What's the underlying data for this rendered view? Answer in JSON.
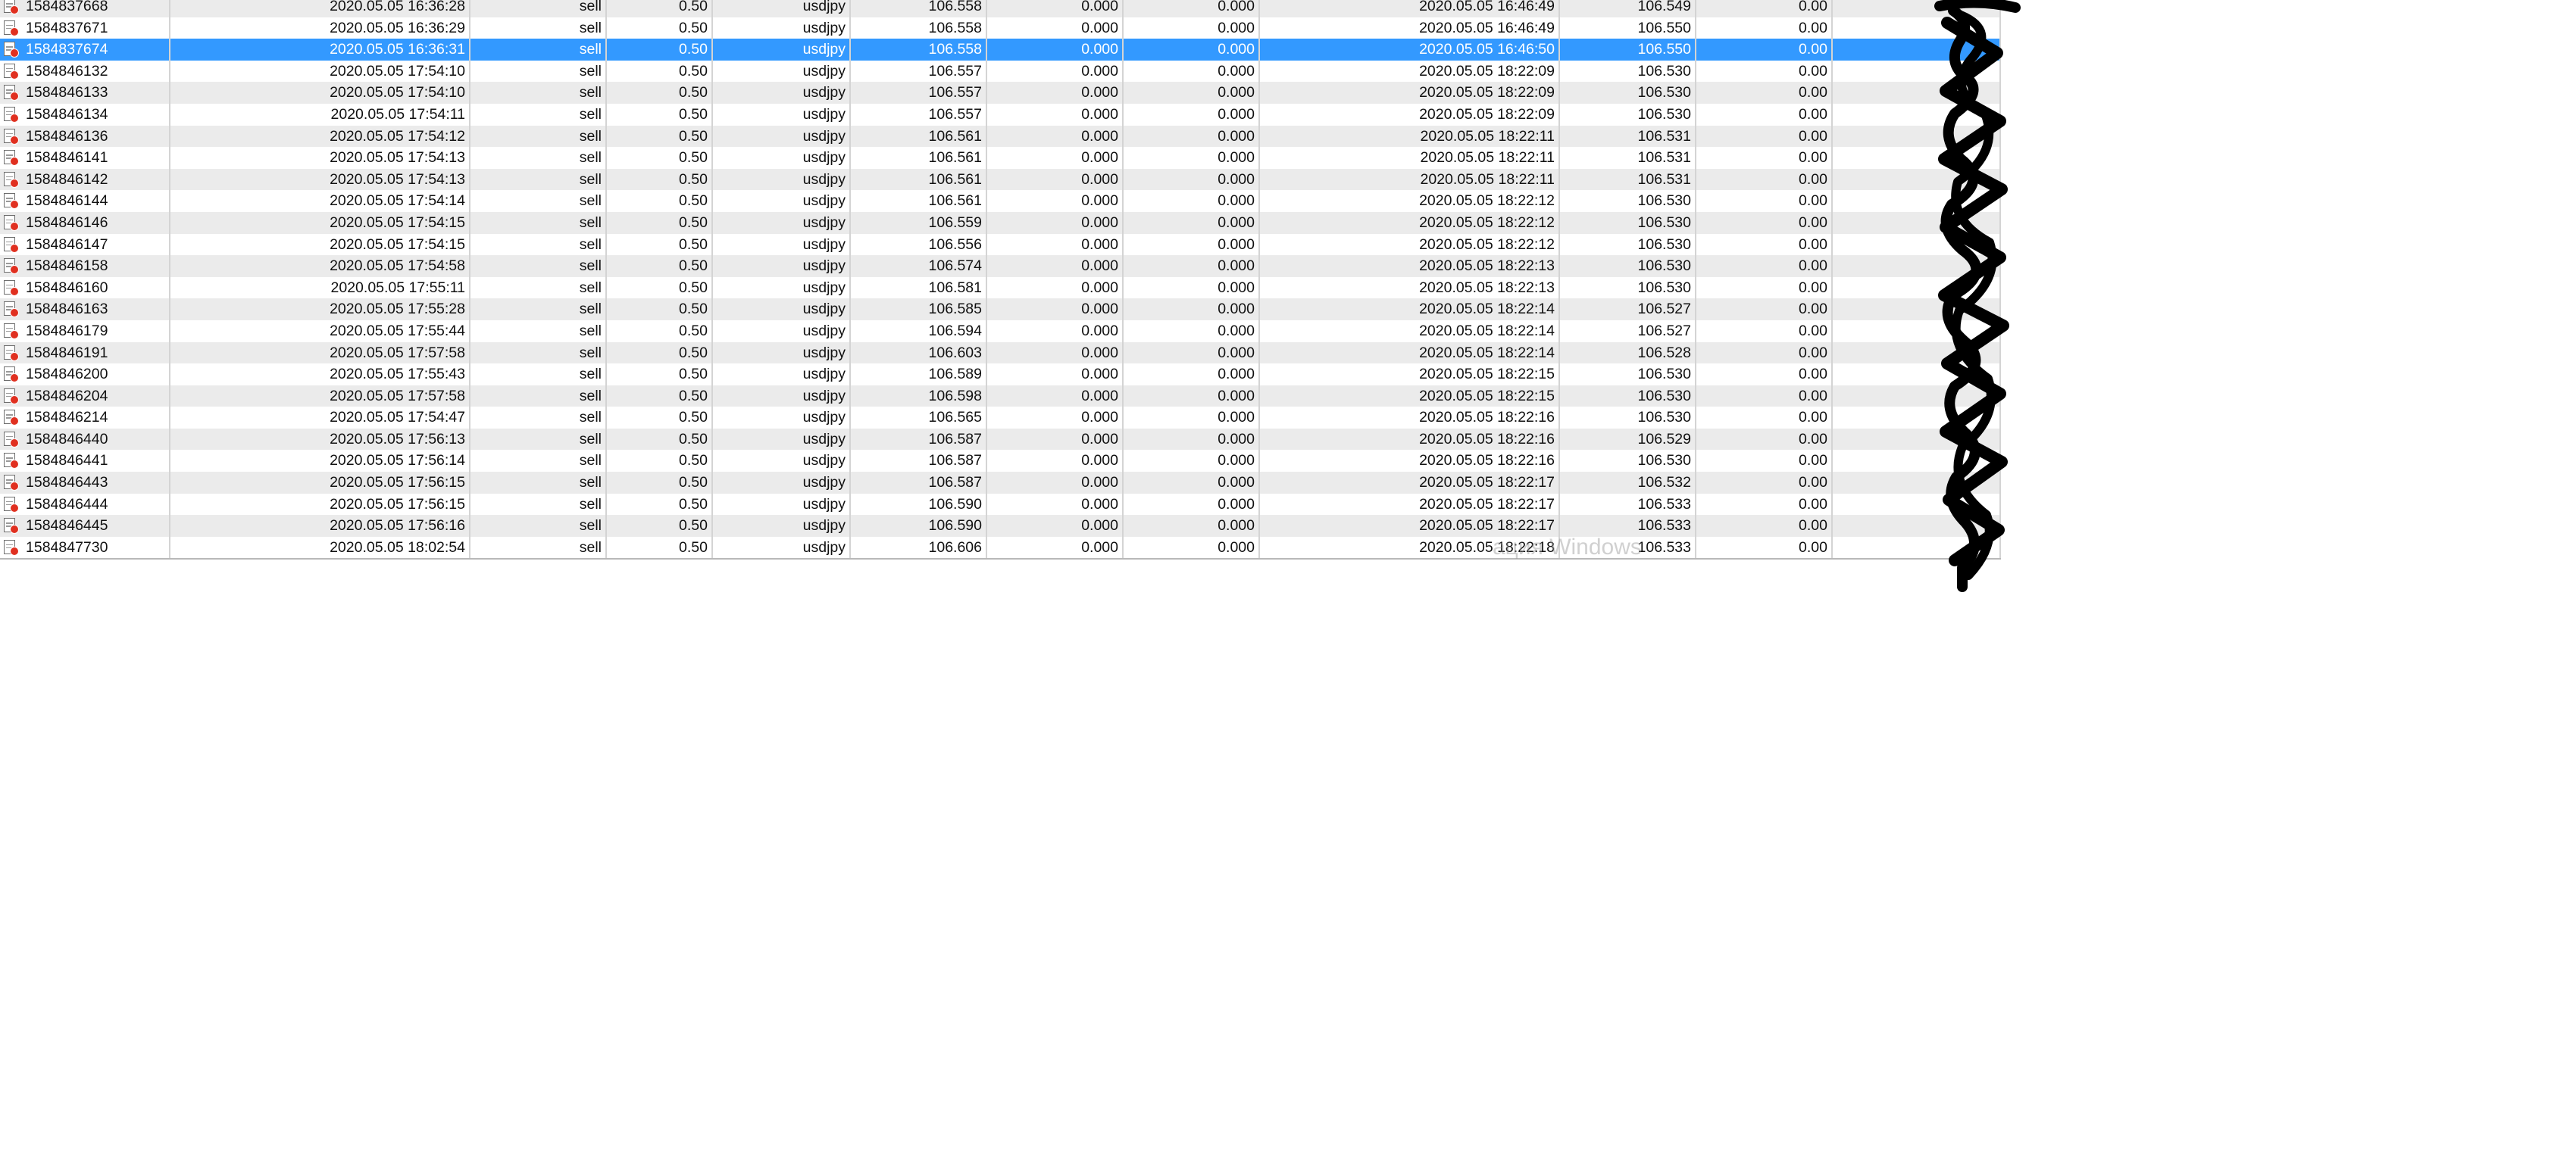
{
  "rows": [
    {
      "ticket": "1584837668",
      "open_time": "2020.05.05 16:36:28",
      "type": "sell",
      "volume": "0.50",
      "symbol": "usdjpy",
      "open_price": "106.558",
      "sl": "0.000",
      "tp": "0.000",
      "close_time": "2020.05.05 16:46:49",
      "close_price": "106.549",
      "commission": "0.00"
    },
    {
      "ticket": "1584837671",
      "open_time": "2020.05.05 16:36:29",
      "type": "sell",
      "volume": "0.50",
      "symbol": "usdjpy",
      "open_price": "106.558",
      "sl": "0.000",
      "tp": "0.000",
      "close_time": "2020.05.05 16:46:49",
      "close_price": "106.550",
      "commission": "0.00"
    },
    {
      "ticket": "1584837674",
      "open_time": "2020.05.05 16:36:31",
      "type": "sell",
      "volume": "0.50",
      "symbol": "usdjpy",
      "open_price": "106.558",
      "sl": "0.000",
      "tp": "0.000",
      "close_time": "2020.05.05 16:46:50",
      "close_price": "106.550",
      "commission": "0.00",
      "selected": true
    },
    {
      "ticket": "1584846132",
      "open_time": "2020.05.05 17:54:10",
      "type": "sell",
      "volume": "0.50",
      "symbol": "usdjpy",
      "open_price": "106.557",
      "sl": "0.000",
      "tp": "0.000",
      "close_time": "2020.05.05 18:22:09",
      "close_price": "106.530",
      "commission": "0.00"
    },
    {
      "ticket": "1584846133",
      "open_time": "2020.05.05 17:54:10",
      "type": "sell",
      "volume": "0.50",
      "symbol": "usdjpy",
      "open_price": "106.557",
      "sl": "0.000",
      "tp": "0.000",
      "close_time": "2020.05.05 18:22:09",
      "close_price": "106.530",
      "commission": "0.00"
    },
    {
      "ticket": "1584846134",
      "open_time": "2020.05.05 17:54:11",
      "type": "sell",
      "volume": "0.50",
      "symbol": "usdjpy",
      "open_price": "106.557",
      "sl": "0.000",
      "tp": "0.000",
      "close_time": "2020.05.05 18:22:09",
      "close_price": "106.530",
      "commission": "0.00"
    },
    {
      "ticket": "1584846136",
      "open_time": "2020.05.05 17:54:12",
      "type": "sell",
      "volume": "0.50",
      "symbol": "usdjpy",
      "open_price": "106.561",
      "sl": "0.000",
      "tp": "0.000",
      "close_time": "2020.05.05 18:22:11",
      "close_price": "106.531",
      "commission": "0.00"
    },
    {
      "ticket": "1584846141",
      "open_time": "2020.05.05 17:54:13",
      "type": "sell",
      "volume": "0.50",
      "symbol": "usdjpy",
      "open_price": "106.561",
      "sl": "0.000",
      "tp": "0.000",
      "close_time": "2020.05.05 18:22:11",
      "close_price": "106.531",
      "commission": "0.00"
    },
    {
      "ticket": "1584846142",
      "open_time": "2020.05.05 17:54:13",
      "type": "sell",
      "volume": "0.50",
      "symbol": "usdjpy",
      "open_price": "106.561",
      "sl": "0.000",
      "tp": "0.000",
      "close_time": "2020.05.05 18:22:11",
      "close_price": "106.531",
      "commission": "0.00"
    },
    {
      "ticket": "1584846144",
      "open_time": "2020.05.05 17:54:14",
      "type": "sell",
      "volume": "0.50",
      "symbol": "usdjpy",
      "open_price": "106.561",
      "sl": "0.000",
      "tp": "0.000",
      "close_time": "2020.05.05 18:22:12",
      "close_price": "106.530",
      "commission": "0.00"
    },
    {
      "ticket": "1584846146",
      "open_time": "2020.05.05 17:54:15",
      "type": "sell",
      "volume": "0.50",
      "symbol": "usdjpy",
      "open_price": "106.559",
      "sl": "0.000",
      "tp": "0.000",
      "close_time": "2020.05.05 18:22:12",
      "close_price": "106.530",
      "commission": "0.00"
    },
    {
      "ticket": "1584846147",
      "open_time": "2020.05.05 17:54:15",
      "type": "sell",
      "volume": "0.50",
      "symbol": "usdjpy",
      "open_price": "106.556",
      "sl": "0.000",
      "tp": "0.000",
      "close_time": "2020.05.05 18:22:12",
      "close_price": "106.530",
      "commission": "0.00"
    },
    {
      "ticket": "1584846158",
      "open_time": "2020.05.05 17:54:58",
      "type": "sell",
      "volume": "0.50",
      "symbol": "usdjpy",
      "open_price": "106.574",
      "sl": "0.000",
      "tp": "0.000",
      "close_time": "2020.05.05 18:22:13",
      "close_price": "106.530",
      "commission": "0.00"
    },
    {
      "ticket": "1584846160",
      "open_time": "2020.05.05 17:55:11",
      "type": "sell",
      "volume": "0.50",
      "symbol": "usdjpy",
      "open_price": "106.581",
      "sl": "0.000",
      "tp": "0.000",
      "close_time": "2020.05.05 18:22:13",
      "close_price": "106.530",
      "commission": "0.00"
    },
    {
      "ticket": "1584846163",
      "open_time": "2020.05.05 17:55:28",
      "type": "sell",
      "volume": "0.50",
      "symbol": "usdjpy",
      "open_price": "106.585",
      "sl": "0.000",
      "tp": "0.000",
      "close_time": "2020.05.05 18:22:14",
      "close_price": "106.527",
      "commission": "0.00"
    },
    {
      "ticket": "1584846179",
      "open_time": "2020.05.05 17:55:44",
      "type": "sell",
      "volume": "0.50",
      "symbol": "usdjpy",
      "open_price": "106.594",
      "sl": "0.000",
      "tp": "0.000",
      "close_time": "2020.05.05 18:22:14",
      "close_price": "106.527",
      "commission": "0.00"
    },
    {
      "ticket": "1584846191",
      "open_time": "2020.05.05 17:57:58",
      "type": "sell",
      "volume": "0.50",
      "symbol": "usdjpy",
      "open_price": "106.603",
      "sl": "0.000",
      "tp": "0.000",
      "close_time": "2020.05.05 18:22:14",
      "close_price": "106.528",
      "commission": "0.00"
    },
    {
      "ticket": "1584846200",
      "open_time": "2020.05.05 17:55:43",
      "type": "sell",
      "volume": "0.50",
      "symbol": "usdjpy",
      "open_price": "106.589",
      "sl": "0.000",
      "tp": "0.000",
      "close_time": "2020.05.05 18:22:15",
      "close_price": "106.530",
      "commission": "0.00"
    },
    {
      "ticket": "1584846204",
      "open_time": "2020.05.05 17:57:58",
      "type": "sell",
      "volume": "0.50",
      "symbol": "usdjpy",
      "open_price": "106.598",
      "sl": "0.000",
      "tp": "0.000",
      "close_time": "2020.05.05 18:22:15",
      "close_price": "106.530",
      "commission": "0.00"
    },
    {
      "ticket": "1584846214",
      "open_time": "2020.05.05 17:54:47",
      "type": "sell",
      "volume": "0.50",
      "symbol": "usdjpy",
      "open_price": "106.565",
      "sl": "0.000",
      "tp": "0.000",
      "close_time": "2020.05.05 18:22:16",
      "close_price": "106.530",
      "commission": "0.00"
    },
    {
      "ticket": "1584846440",
      "open_time": "2020.05.05 17:56:13",
      "type": "sell",
      "volume": "0.50",
      "symbol": "usdjpy",
      "open_price": "106.587",
      "sl": "0.000",
      "tp": "0.000",
      "close_time": "2020.05.05 18:22:16",
      "close_price": "106.529",
      "commission": "0.00"
    },
    {
      "ticket": "1584846441",
      "open_time": "2020.05.05 17:56:14",
      "type": "sell",
      "volume": "0.50",
      "symbol": "usdjpy",
      "open_price": "106.587",
      "sl": "0.000",
      "tp": "0.000",
      "close_time": "2020.05.05 18:22:16",
      "close_price": "106.530",
      "commission": "0.00"
    },
    {
      "ticket": "1584846443",
      "open_time": "2020.05.05 17:56:15",
      "type": "sell",
      "volume": "0.50",
      "symbol": "usdjpy",
      "open_price": "106.587",
      "sl": "0.000",
      "tp": "0.000",
      "close_time": "2020.05.05 18:22:17",
      "close_price": "106.532",
      "commission": "0.00"
    },
    {
      "ticket": "1584846444",
      "open_time": "2020.05.05 17:56:15",
      "type": "sell",
      "volume": "0.50",
      "symbol": "usdjpy",
      "open_price": "106.590",
      "sl": "0.000",
      "tp": "0.000",
      "close_time": "2020.05.05 18:22:17",
      "close_price": "106.533",
      "commission": "0.00"
    },
    {
      "ticket": "1584846445",
      "open_time": "2020.05.05 17:56:16",
      "type": "sell",
      "volume": "0.50",
      "symbol": "usdjpy",
      "open_price": "106.590",
      "sl": "0.000",
      "tp": "0.000",
      "close_time": "2020.05.05 18:22:17",
      "close_price": "106.533",
      "commission": "0.00"
    },
    {
      "ticket": "1584847730",
      "open_time": "2020.05.05 18:02:54",
      "type": "sell",
      "volume": "0.50",
      "symbol": "usdjpy",
      "open_price": "106.606",
      "sl": "0.000",
      "tp": "0.000",
      "close_time": "2020.05.05 18:22:18",
      "close_price": "106.533",
      "commission": "0.00"
    }
  ],
  "watermark": "ация Windows",
  "icons": {
    "row": "closed-order-icon",
    "redaction": "black-scribble-redaction"
  },
  "colors": {
    "selected_row": "#3399ff",
    "alt_row": "#ebebeb",
    "order_dot": "#e03020",
    "scribble": "#000000"
  }
}
